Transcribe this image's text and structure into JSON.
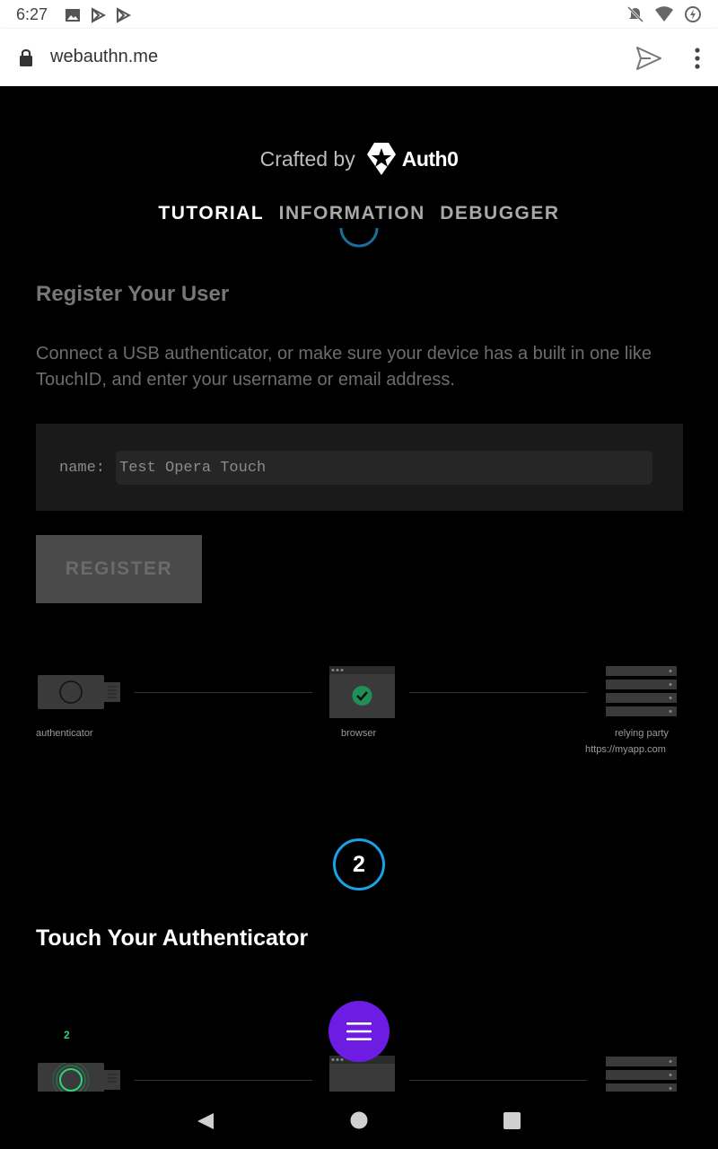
{
  "status_bar": {
    "time": "6:27",
    "left_icons": [
      "image-icon",
      "play-store-icon",
      "play-store-icon"
    ],
    "right_icons": [
      "bell-off-icon",
      "wifi-icon",
      "battery-charging-icon"
    ]
  },
  "browser": {
    "url": "webauthn.me",
    "actions": [
      "send-icon",
      "more-vert-icon"
    ]
  },
  "header": {
    "crafted_by": "Crafted by",
    "brand": "Auth0"
  },
  "nav": {
    "tutorial": "TUTORIAL",
    "information": "INFORMATION",
    "debugger": "DEBUGGER",
    "active": "TUTORIAL"
  },
  "step1": {
    "title": "Register Your User",
    "description": "Connect a USB authenticator, or make sure your device has a built in one like TouchID, and enter your username or email address.",
    "name_label": "name:",
    "name_value": "Test Opera Touch",
    "register_button": "REGISTER"
  },
  "diagram": {
    "authenticator": "authenticator",
    "browser": "browser",
    "relying_party": "relying party",
    "relying_party_url": "https://myapp.com"
  },
  "step2": {
    "number": "2",
    "title": "Touch Your Authenticator",
    "indicator": "2"
  },
  "colors": {
    "accent_blue": "#19a2e8",
    "fab_purple": "#6d1ce3",
    "success_green": "#1f8f57"
  }
}
